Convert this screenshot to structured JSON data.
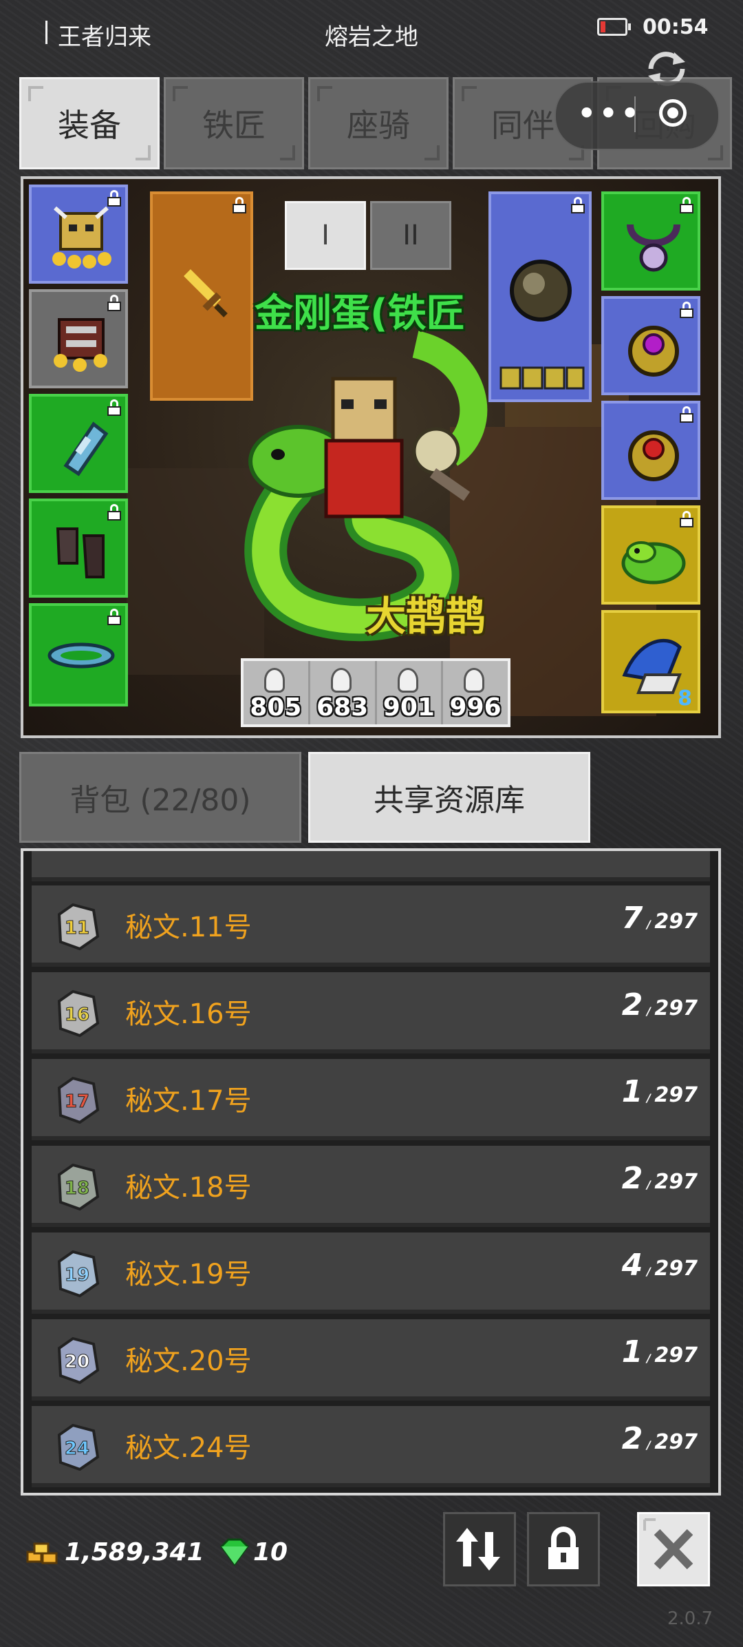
{
  "status_bar": {
    "app_title": "王者归来",
    "location": "熔岩之地",
    "time": "00:54"
  },
  "top_tabs": [
    {
      "label": "装备",
      "active": true
    },
    {
      "label": "铁匠",
      "active": false
    },
    {
      "label": "座骑",
      "active": false
    },
    {
      "label": "同伴",
      "active": false
    },
    {
      "label": "回购",
      "active": false
    }
  ],
  "equipment": {
    "page_buttons": [
      "I",
      "II"
    ],
    "character_name": "金刚蛋(铁匠",
    "pet_name": "大鹊鹊",
    "potions": [
      "805",
      "683",
      "901",
      "996"
    ],
    "corner_badge": "8"
  },
  "inventory_tabs": [
    {
      "label": "背包 (22/80)",
      "active": false
    },
    {
      "label": "共享资源库",
      "active": true
    }
  ],
  "list": {
    "items": [
      {
        "name": "秘文.11号",
        "count": "7",
        "max": "297",
        "badge": "11",
        "badge_color": "#f1cf3b",
        "stone": "#b8b8b8"
      },
      {
        "name": "秘文.16号",
        "count": "2",
        "max": "297",
        "badge": "16",
        "badge_color": "#e6d14a",
        "stone": "#b5b5b5"
      },
      {
        "name": "秘文.17号",
        "count": "1",
        "max": "297",
        "badge": "17",
        "badge_color": "#e5553f",
        "stone": "#8a8aa0"
      },
      {
        "name": "秘文.18号",
        "count": "2",
        "max": "297",
        "badge": "18",
        "badge_color": "#7fb34a",
        "stone": "#9aa39a"
      },
      {
        "name": "秘文.19号",
        "count": "4",
        "max": "297",
        "badge": "19",
        "badge_color": "#8fd2ff",
        "stone": "#a5bad0"
      },
      {
        "name": "秘文.20号",
        "count": "1",
        "max": "297",
        "badge": "20",
        "badge_color": "#ffffff",
        "stone": "#9aa3c2"
      },
      {
        "name": "秘文.24号",
        "count": "2",
        "max": "297",
        "badge": "24",
        "badge_color": "#6ec8ff",
        "stone": "#8f9fbf"
      }
    ]
  },
  "footer": {
    "gold": "1,589,341",
    "gems": "10",
    "version": "2.0.7"
  },
  "colors": {
    "item_name": "#f0a21e",
    "char_name": "#3fe04a",
    "pet_name": "#e8d531"
  }
}
